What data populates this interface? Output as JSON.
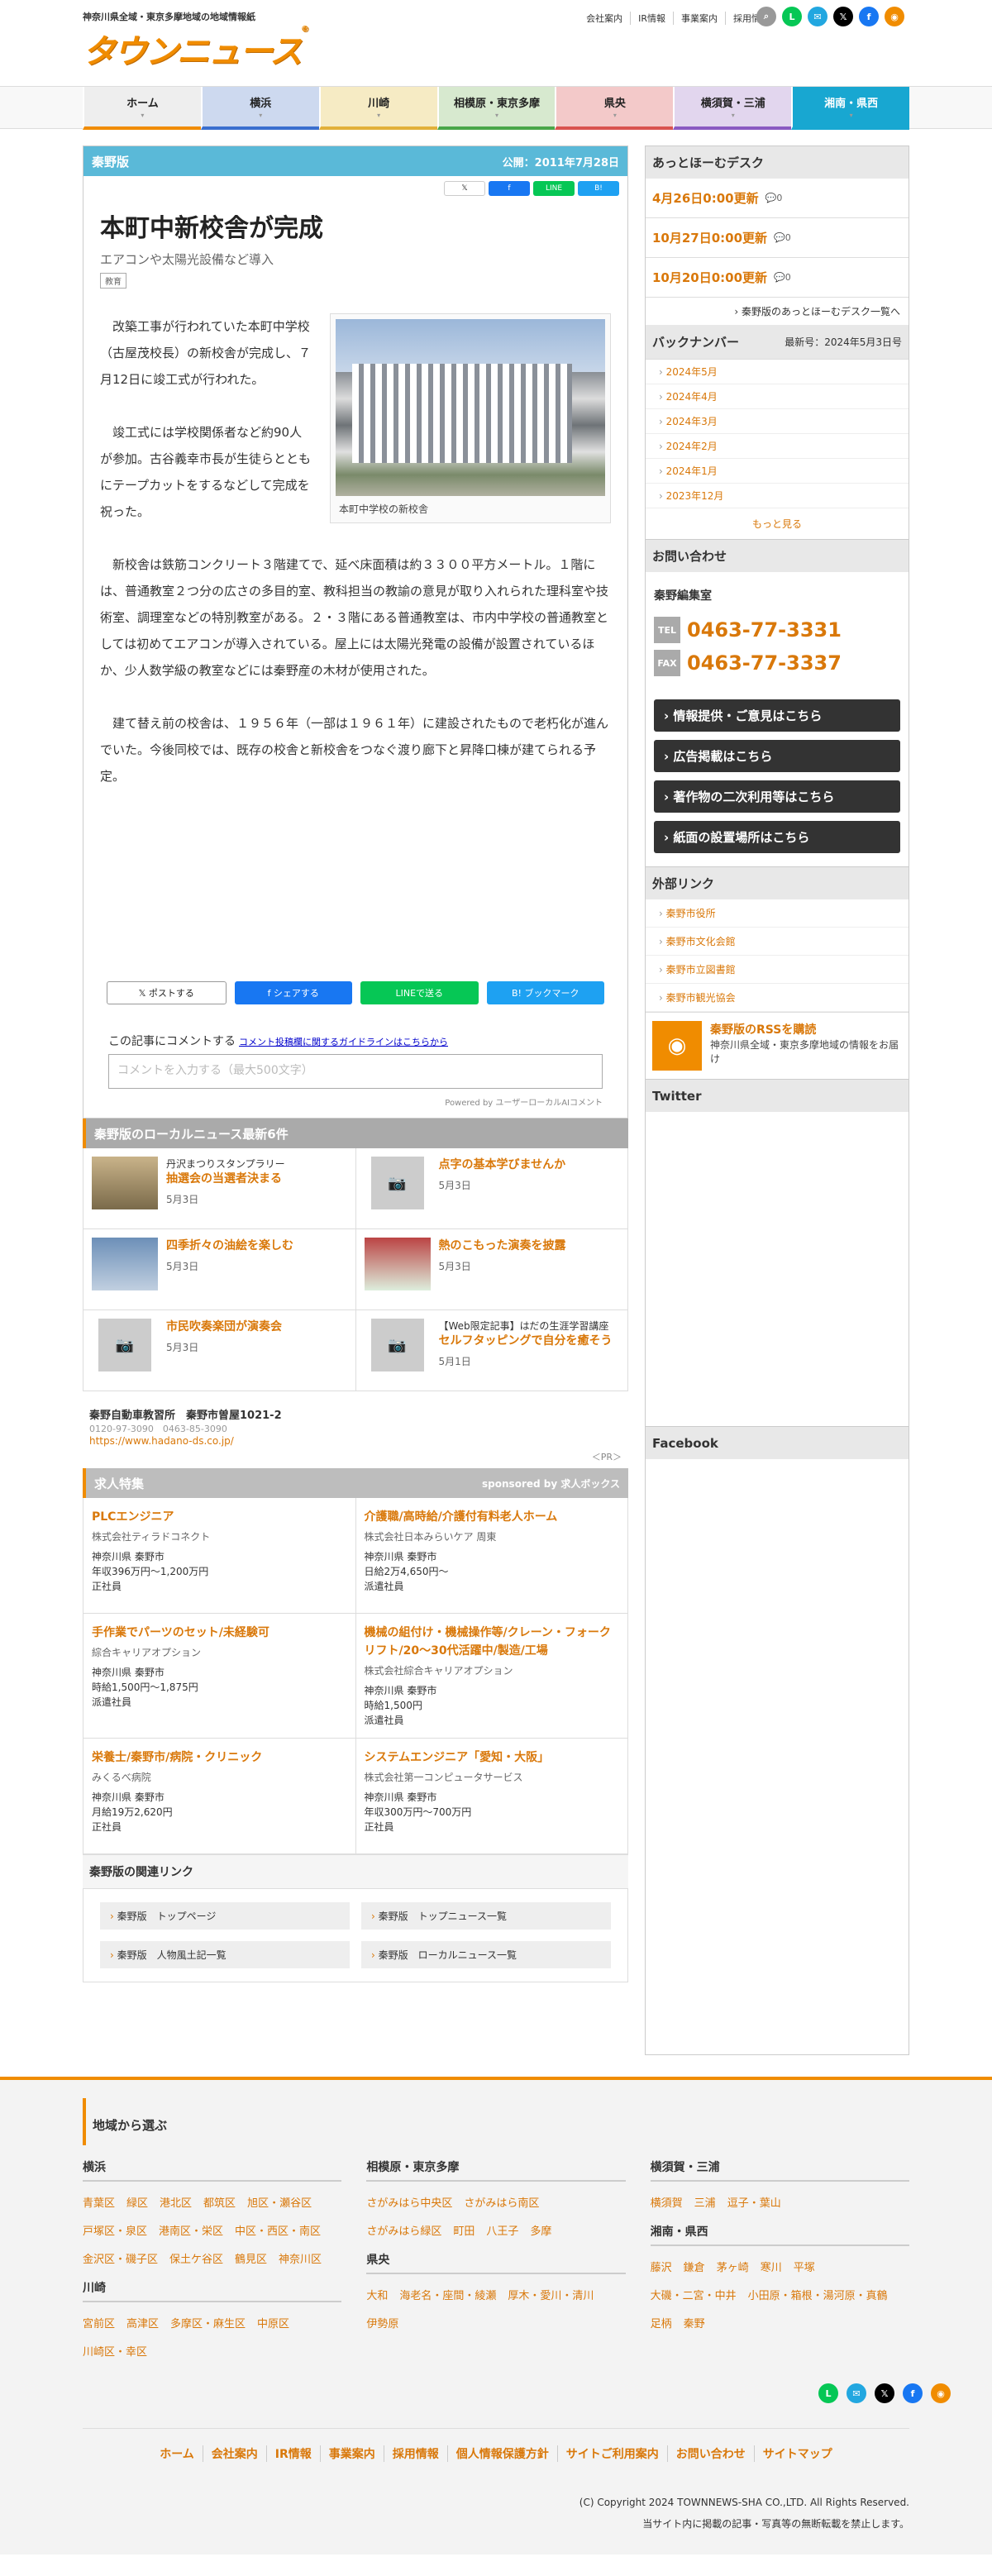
{
  "header": {
    "tagline": "神奈川県全域・東京多摩地域の地域情報紙",
    "logo_text": "タウンニュース",
    "logo_mark": "®",
    "links": [
      "会社案内",
      "IR情報",
      "事業案内",
      "採用情報"
    ],
    "social": [
      {
        "name": "search-icon",
        "glyph": "⌕",
        "color": "#999999"
      },
      {
        "name": "line-icon",
        "glyph": "L",
        "color": "#06c755"
      },
      {
        "name": "chat-icon",
        "glyph": "✉",
        "color": "#22a7e0"
      },
      {
        "name": "x-icon",
        "glyph": "𝕏",
        "color": "#000000"
      },
      {
        "name": "facebook-icon",
        "glyph": "f",
        "color": "#1877f2"
      },
      {
        "name": "rss-icon",
        "glyph": "◉",
        "color": "#f08c00"
      }
    ]
  },
  "nav": [
    {
      "label": "ホーム",
      "color": "#eeeeee",
      "border": "#f08c00",
      "text": "#222222"
    },
    {
      "label": "横浜",
      "color": "#cdd9ef",
      "border": "#3a6fcf",
      "text": "#222222"
    },
    {
      "label": "川崎",
      "color": "#f6ebc4",
      "border": "#e2b03a",
      "text": "#222222"
    },
    {
      "label": "相模原・東京多摩",
      "color": "#d7e9cf",
      "border": "#4aa64a",
      "text": "#222222"
    },
    {
      "label": "県央",
      "color": "#f3c9c9",
      "border": "#d9534f",
      "text": "#222222"
    },
    {
      "label": "横須賀・三浦",
      "color": "#e2d6ee",
      "border": "#8a5ac2",
      "text": "#222222"
    },
    {
      "label": "湘南・県西",
      "color": "#18a7d1",
      "border": "#18a7d1",
      "text": "#ffffff"
    }
  ],
  "article": {
    "edition": "秦野版",
    "published": "公開：2011年7月28日",
    "share_small": [
      "𝕏",
      "f",
      "LINE",
      "B!"
    ],
    "title": "本町中新校舎が完成",
    "subtitle": "エアコンや太陽光設備など導入",
    "tag": "教育",
    "photo_caption": "本町中学校の新校舎",
    "paragraphs": [
      "改築工事が行われていた本町中学校（古屋茂校長）の新校舎が完成し、７月12日に竣工式が行われた。",
      "竣工式には学校関係者など約90人が参加。古谷義幸市長が生徒らとともにテープカットをするなどして完成を祝った。",
      "新校舎は鉄筋コンクリート３階建てで、延べ床面積は約３３００平方メートル。１階には、普通教室２つ分の広さの多目的室、教科担当の教諭の意見が取り入れられた理科室や技術室、調理室などの特別教室がある。２・３階にある普通教室は、市内中学校の普通教室としては初めてエアコンが導入されている。屋上には太陽光発電の設備が設置されているほか、少人数学級の教室などには秦野産の木材が使用された。",
      "建て替え前の校舎は、１９５６年（一部は１９６１年）に建設されたもので老朽化が進んでいた。今後同校では、既存の校舎と新校舎をつなぐ渡り廊下と昇降口棟が建てられる予定。"
    ],
    "share_buttons": [
      {
        "label": "𝕏  ポストする",
        "bg": "#ffffff",
        "fg": "#222222"
      },
      {
        "label": "f  シェアする",
        "bg": "#1877f2",
        "fg": "#ffffff"
      },
      {
        "label": "LINEで送る",
        "bg": "#06c755",
        "fg": "#ffffff"
      },
      {
        "label": "B! ブックマーク",
        "bg": "#1ea1f2",
        "fg": "#ffffff"
      }
    ],
    "comment_title": "この記事にコメントする",
    "comment_guide": "コメント投稿欄に関するガイドラインはこちらから",
    "comment_placeholder": "コメントを入力する（最大500文字）",
    "powered": "Powered by ユーザーローカルAIコメント"
  },
  "local_news": {
    "heading": "秦野版のローカルニュース最新6件",
    "items": [
      {
        "small": "丹沢まつりスタンプラリー",
        "title": "抽選会の当選者決まる",
        "date": "5月3日",
        "thumb": "photo"
      },
      {
        "small": "",
        "title": "点字の基本学びませんか",
        "date": "5月3日",
        "thumb": "none"
      },
      {
        "small": "",
        "title": "四季折々の油絵を楽しむ",
        "date": "5月3日",
        "thumb": "photo"
      },
      {
        "small": "",
        "title": "熱のこもった演奏を披露",
        "date": "5月3日",
        "thumb": "photo"
      },
      {
        "small": "",
        "title": "市民吹奏楽団が演奏会",
        "date": "5月3日",
        "thumb": "none"
      },
      {
        "small": "【Web限定記事】はだの生涯学習講座",
        "title": "セルフタッピングで自分を癒そう",
        "date": "5月1日",
        "thumb": "none"
      }
    ]
  },
  "pr": {
    "name": "秦野自動車教習所　秦野市曽屋1021-2",
    "phones": "0120-97-3090　0463-85-3090",
    "url": "https://www.hadano-ds.co.jp/",
    "label": "＜PR＞"
  },
  "jobs": {
    "heading": "求人特集",
    "sponsor": "sponsored by 求人ボックス",
    "items": [
      {
        "title": "PLCエンジニア",
        "company": "株式会社ティラドコネクト",
        "place": "神奈川県 秦野市",
        "pay": "年収396万円〜1,200万円",
        "type": "正社員"
      },
      {
        "title": "介護職/高時給/介護付有料老人ホーム",
        "company": "株式会社日本みらいケア 周東",
        "place": "神奈川県 秦野市",
        "pay": "日給2万4,650円〜",
        "type": "派遣社員"
      },
      {
        "title": "手作業でパーツのセット/未経験可",
        "company": "綜合キャリアオプション",
        "place": "神奈川県 秦野市",
        "pay": "時給1,500円〜1,875円",
        "type": "派遣社員"
      },
      {
        "title": "機械の組付け・機械操作等/クレーン・フォークリフト/20〜30代活躍中/製造/工場",
        "company": "株式会社綜合キャリアオプション",
        "place": "神奈川県 秦野市",
        "pay": "時給1,500円",
        "type": "派遣社員"
      },
      {
        "title": "栄養士/秦野市/病院・クリニック",
        "company": "みくるべ病院",
        "place": "神奈川県 秦野市",
        "pay": "月給19万2,620円",
        "type": "正社員"
      },
      {
        "title": "システムエンジニア「愛知・大阪」",
        "company": "株式会社第一コンピュータサービス",
        "place": "神奈川県 秦野市",
        "pay": "年収300万円〜700万円",
        "type": "正社員"
      }
    ]
  },
  "related": {
    "heading": "秦野版の関連リンク",
    "links": [
      "秦野版　トップページ",
      "秦野版　トップニュース一覧",
      "秦野版　人物風土記一覧",
      "秦野版　ローカルニュース一覧"
    ]
  },
  "sidebar": {
    "desk_heading": "あっとほーむデスク",
    "updates": [
      "4月26日0:00更新",
      "10月27日0:00更新",
      "10月20日0:00更新"
    ],
    "update_count": "0",
    "desk_more": "秦野版のあっとほーむデスク一覧へ",
    "backnumber_heading": "バックナンバー",
    "backnumber_latest": "最新号：2024年5月3日号",
    "backnumbers": [
      "2024年5月",
      "2024年4月",
      "2024年3月",
      "2024年2月",
      "2024年1月",
      "2023年12月"
    ],
    "see_more": "もっと見る",
    "contact_heading": "お問い合わせ",
    "editorial": "秦野編集室",
    "tel_label": "TEL",
    "tel": "0463-77-3331",
    "fax_label": "FAX",
    "fax": "0463-77-3337",
    "buttons": [
      "情報提供・ご意見はこちら",
      "広告掲載はこちら",
      "著作物の二次利用等はこちら",
      "紙面の設置場所はこちら"
    ],
    "ext_heading": "外部リンク",
    "ext_links": [
      "秦野市役所",
      "秦野市文化会館",
      "秦野市立図書館",
      "秦野市観光協会"
    ],
    "rss_title": "秦野版のRSSを購読",
    "rss_desc": "神奈川県全域・東京多摩地域の情報をお届け",
    "twitter": "Twitter",
    "facebook": "Facebook"
  },
  "footer": {
    "heading": "地域から選ぶ",
    "col1": [
      {
        "region": "横浜",
        "areas": [
          "青葉区",
          "緑区",
          "港北区",
          "都筑区",
          "旭区・瀬谷区",
          "戸塚区・泉区",
          "港南区・栄区",
          "中区・西区・南区",
          "金沢区・磯子区",
          "保土ケ谷区",
          "鶴見区",
          "神奈川区"
        ]
      },
      {
        "region": "川崎",
        "areas": [
          "宮前区",
          "高津区",
          "多摩区・麻生区",
          "中原区",
          "川崎区・幸区"
        ]
      }
    ],
    "col2": [
      {
        "region": "相模原・東京多摩",
        "areas": [
          "さがみはら中央区",
          "さがみはら南区",
          "さがみはら緑区",
          "町田",
          "八王子",
          "多摩"
        ]
      },
      {
        "region": "県央",
        "areas": [
          "大和",
          "海老名・座間・綾瀬",
          "厚木・愛川・清川",
          "伊勢原"
        ]
      }
    ],
    "col3": [
      {
        "region": "横須賀・三浦",
        "areas": [
          "横須賀",
          "三浦",
          "逗子・葉山"
        ]
      },
      {
        "region": "湘南・県西",
        "areas": [
          "藤沢",
          "鎌倉",
          "茅ヶ崎",
          "寒川",
          "平塚",
          "大磯・二宮・中井",
          "小田原・箱根・湯河原・真鶴",
          "足柄",
          "秦野"
        ]
      }
    ],
    "nav": [
      "ホーム",
      "会社案内",
      "IR情報",
      "事業案内",
      "採用情報",
      "個人情報保護方針",
      "サイトご利用案内",
      "お問い合わせ",
      "サイトマップ"
    ],
    "copyright": "(C) Copyright 2024 TOWNNEWS-SHA CO.,LTD. All Rights Reserved.",
    "notice": "当サイト内に掲載の記事・写真等の無断転載を禁止します。"
  }
}
